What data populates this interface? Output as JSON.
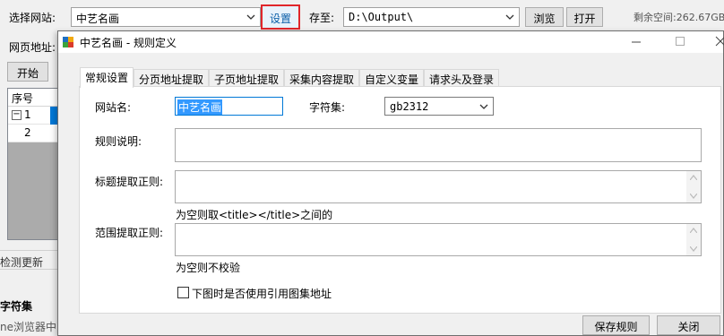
{
  "main": {
    "site_label": "选择网站:",
    "site_value": "中艺名画",
    "settings_button": "设置",
    "save_to_label": "存至:",
    "save_path": "D:\\Output\\",
    "browse_button": "浏览",
    "open_button": "打开",
    "free_space_label": "剩余空间:262.67GB",
    "url_label": "网页地址:",
    "start_button": "开始",
    "grid": {
      "header": "序号",
      "rows": [
        "1",
        "2"
      ],
      "expander": "−"
    },
    "check_update": "检测更新",
    "charset_heading": "字符集",
    "browser_text": "ne浏览器中"
  },
  "dialog": {
    "title": "中艺名画 - 规则定义",
    "tabs": [
      "常规设置",
      "分页地址提取",
      "子页地址提取",
      "采集内容提取",
      "自定义变量",
      "请求头及登录"
    ],
    "active_tab": 0,
    "site_name_label": "网站名:",
    "site_name_value": "中艺名画",
    "charset_label": "字符集:",
    "charset_value": "gb2312",
    "rule_desc_label": "规则说明:",
    "title_regex_label": "标题提取正则:",
    "title_regex_hint": "为空则取<title></title>之间的",
    "range_regex_label": "范围提取正则:",
    "range_regex_hint": "为空则不校验",
    "checkbox_label": "下图时是否使用引用图集地址",
    "save_button": "保存规则",
    "close_button": "关闭"
  },
  "colors": {
    "accent": "#0078d7",
    "highlight_border": "#e0262b",
    "selection": "#3399ff"
  }
}
